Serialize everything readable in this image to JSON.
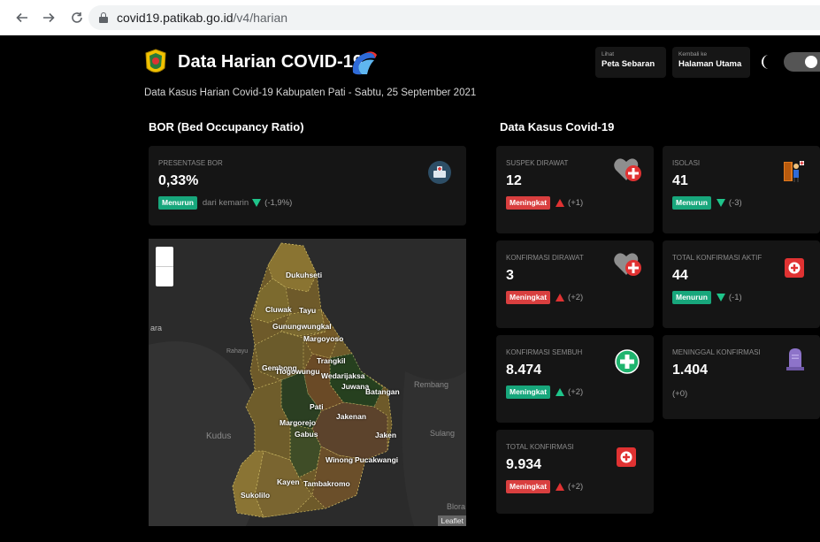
{
  "browser": {
    "back_icon": "arrow-left-icon",
    "forward_icon": "arrow-right-icon",
    "reload_icon": "reload-icon",
    "url_host": "covid19.patikab.go.id",
    "url_path": "/v4/harian"
  },
  "header": {
    "title": "Data Harian COVID-19",
    "subtitle": "Data Kasus Harian Covid-19 Kabupaten Pati - Sabtu, 25 September 2021",
    "peta_small": "Lihat",
    "peta_big": "Peta Sebaran",
    "halaman_small": "Kembali ke",
    "halaman_big": "Halaman Utama"
  },
  "sections": {
    "bor": "BOR (Bed Occupancy Ratio)",
    "kasus": "Data Kasus Covid-19"
  },
  "bor_card": {
    "label": "PRESENTASE BOR",
    "value": "0,33%",
    "badge": "Menurun",
    "extra": "dari kemarin",
    "change": "(-1,9%)"
  },
  "cards": {
    "suspek": {
      "label": "SUSPEK DIRAWAT",
      "value": "12",
      "badge": "Meningkat",
      "change": "(+1)"
    },
    "isolasi": {
      "label": "ISOLASI",
      "value": "41",
      "badge": "Menurun",
      "change": "(-3)"
    },
    "konf_dirawat": {
      "label": "KONFIRMASI DIRAWAT",
      "value": "3",
      "badge": "Meningkat",
      "change": "(+2)"
    },
    "total_aktif": {
      "label": "TOTAL KONFIRMASI AKTIF",
      "value": "44",
      "badge": "Menurun",
      "change": "(-1)"
    },
    "sembuh": {
      "label": "KONFIRMASI SEMBUH",
      "value": "8.474",
      "badge": "Meningkat",
      "change": "(+2)"
    },
    "meninggal": {
      "label": "MENINGGAL KONFIRMASI",
      "value": "1.404",
      "change": "(+0)"
    },
    "total": {
      "label": "TOTAL KONFIRMASI",
      "value": "9.934",
      "badge": "Meningkat",
      "change": "(+2)"
    }
  },
  "map": {
    "attribution": "Leaflet",
    "districts": [
      "Dukuhseti",
      "Tayu",
      "Cluwak",
      "Gunungwungkal",
      "Margoyoso",
      "Trangkil",
      "Gembong",
      "Tlogowungu",
      "Wedarijaksa",
      "Juwana",
      "Batangan",
      "Pati",
      "Jakenan",
      "Margorejo",
      "Gabus",
      "Jaken",
      "Winong",
      "Pucakwangi",
      "Kayen",
      "Tambakromo",
      "Sukolilo"
    ],
    "outer_labels": [
      "ara",
      "Rembang",
      "Kudus",
      "Sulang",
      "Blora",
      "Rahayu"
    ]
  },
  "colors": {
    "menurun": "#18a77c",
    "meningkat": "#d93f3f",
    "card_bg": "#151515"
  }
}
